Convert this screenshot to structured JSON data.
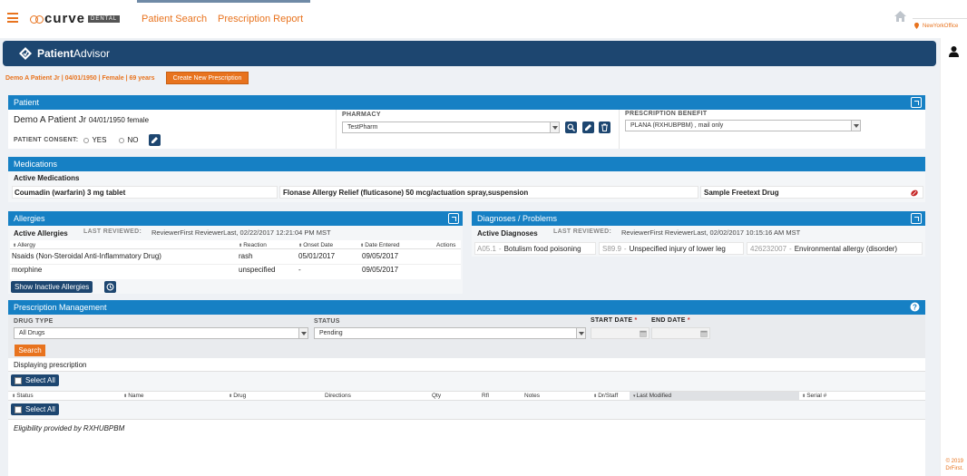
{
  "nav": {
    "logo": "curve",
    "logo_sub": "DENTAL",
    "links": [
      "Patient Search",
      "Prescription Report"
    ],
    "office": "NewYorkOffice"
  },
  "footer": {
    "copyright_line1": "© 2019",
    "copyright_line2": "DrFirst."
  },
  "advisor": {
    "logo_bold": "Patient",
    "logo_rest": "Advisor"
  },
  "patient_line": "Demo A Patient Jr | 04/01/1950 | Female | 69 years",
  "create_button": "Create New Prescription",
  "patient": {
    "title": "Patient",
    "name": "Demo A Patient Jr",
    "dob_sex": "04/01/1950 female",
    "consent_label": "PATIENT CONSENT:",
    "yes": "YES",
    "no": "NO",
    "pharmacy_label": "PHARMACY",
    "pharmacy_value": "TestPharm",
    "benefit_label": "PRESCRIPTION BENEFIT",
    "benefit_value": "PLANA (RXHUBPBM) , mail only"
  },
  "medications": {
    "title": "Medications",
    "subtitle": "Active Medications",
    "items": [
      "Coumadin (warfarin) 3 mg tablet",
      "Flonase Allergy Relief (fluticasone) 50 mcg/actuation spray,suspension",
      "Sample Freetext Drug"
    ]
  },
  "allergies": {
    "title": "Allergies",
    "subtitle": "Active Allergies",
    "reviewed_label": "LAST REVIEWED:",
    "reviewed_value": "ReviewerFirst ReviewerLast, 02/22/2017 12:21:04 PM MST",
    "columns": [
      "Allergy",
      "Reaction",
      "Onset Date",
      "Date Entered",
      "Actions"
    ],
    "rows": [
      [
        "Nsaids (Non-Steroidal Anti-Inflammatory Drug)",
        "rash",
        "05/01/2017",
        "09/05/2017"
      ],
      [
        "morphine",
        "unspecified",
        "-",
        "09/05/2017"
      ]
    ],
    "show_inactive": "Show Inactive Allergies"
  },
  "diagnoses": {
    "title": "Diagnoses / Problems",
    "subtitle": "Active Diagnoses",
    "reviewed_label": "LAST REVIEWED:",
    "reviewed_value": "ReviewerFirst ReviewerLast, 02/02/2017 10:15:16 AM MST",
    "items": [
      {
        "code": "A05.1",
        "desc": "Botulism food poisoning"
      },
      {
        "code": "S89.9",
        "desc": "Unspecified injury of lower leg"
      },
      {
        "code": "426232007",
        "desc": "Environmental allergy (disorder)"
      }
    ]
  },
  "rx": {
    "title": "Prescription Management",
    "drug_type_label": "DRUG TYPE",
    "drug_type_value": "All Drugs",
    "status_label": "STATUS",
    "status_value": "Pending",
    "start_label": "START DATE",
    "end_label": "END DATE",
    "required": "*",
    "search": "Search",
    "displaying": "Displaying prescription",
    "select_all": "Select All",
    "columns": [
      "Status",
      "Name",
      "Drug",
      "Directions",
      "Qty",
      "Rfl",
      "Notes",
      "Dr/Staff",
      "Last Modified",
      "Serial #"
    ],
    "eligibility": "Eligibility provided by RXHUBPBM"
  },
  "colors": {
    "accent": "#e8731e",
    "header_blue": "#1680c4",
    "navy": "#1d4670"
  }
}
